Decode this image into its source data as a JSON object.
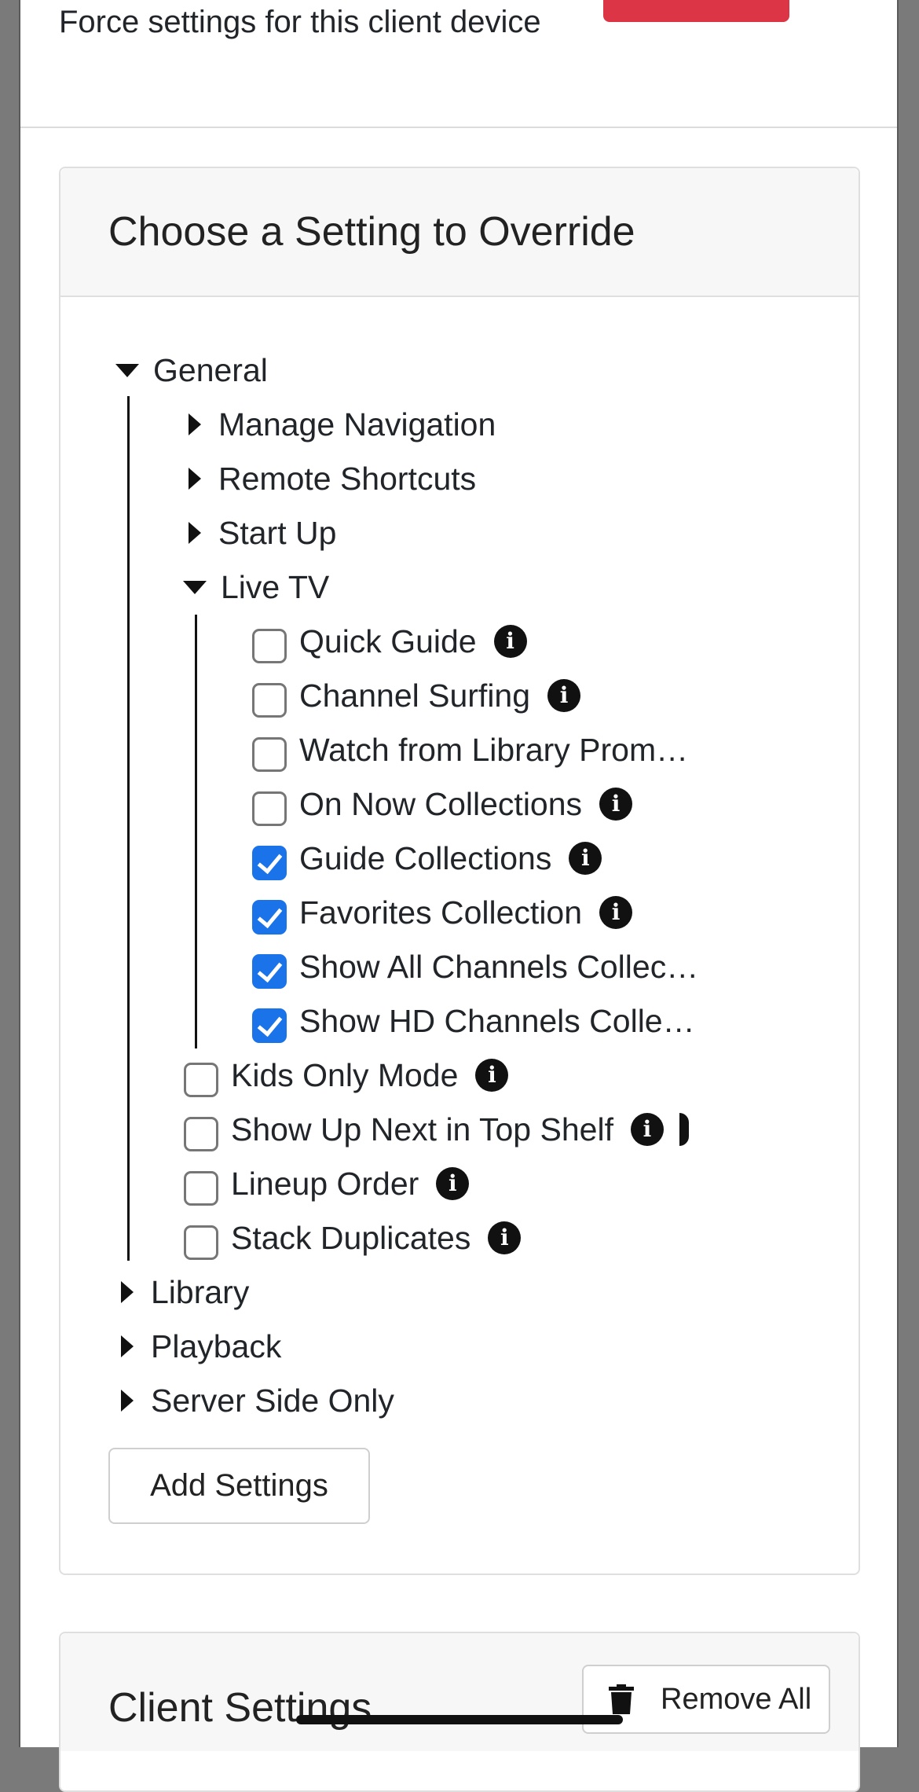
{
  "top": {
    "description": "Force settings for this client device"
  },
  "override_panel": {
    "title": "Choose a Setting to Override",
    "tree": {
      "general": "General",
      "manage_navigation": "Manage Navigation",
      "remote_shortcuts": "Remote Shortcuts",
      "start_up": "Start Up",
      "live_tv": "Live TV",
      "live_tv_items": [
        {
          "label": "Quick Guide",
          "checked": false,
          "info": true
        },
        {
          "label": "Channel Surfing",
          "checked": false,
          "info": true
        },
        {
          "label": "Watch from Library Prom…",
          "checked": false,
          "info": false
        },
        {
          "label": "On Now Collections",
          "checked": false,
          "info": true
        },
        {
          "label": "Guide Collections",
          "checked": true,
          "info": true
        },
        {
          "label": "Favorites Collection",
          "checked": true,
          "info": true
        },
        {
          "label": "Show All Channels Collec…",
          "checked": true,
          "info": false
        },
        {
          "label": "Show HD Channels Colle…",
          "checked": true,
          "info": false
        }
      ],
      "general_items": [
        {
          "label": "Kids Only Mode",
          "checked": false,
          "info": true
        },
        {
          "label": "Show Up Next in Top Shelf",
          "checked": false,
          "info": true
        },
        {
          "label": "Lineup Order",
          "checked": false,
          "info": true
        },
        {
          "label": "Stack Duplicates",
          "checked": false,
          "info": true
        }
      ],
      "library": "Library",
      "playback": "Playback",
      "server_side_only": "Server Side Only"
    },
    "add_button": "Add Settings"
  },
  "client_panel": {
    "title": "Client Settings",
    "remove_all": "Remove All"
  },
  "colors": {
    "accent": "#1a73e8",
    "danger": "#dc3545"
  }
}
